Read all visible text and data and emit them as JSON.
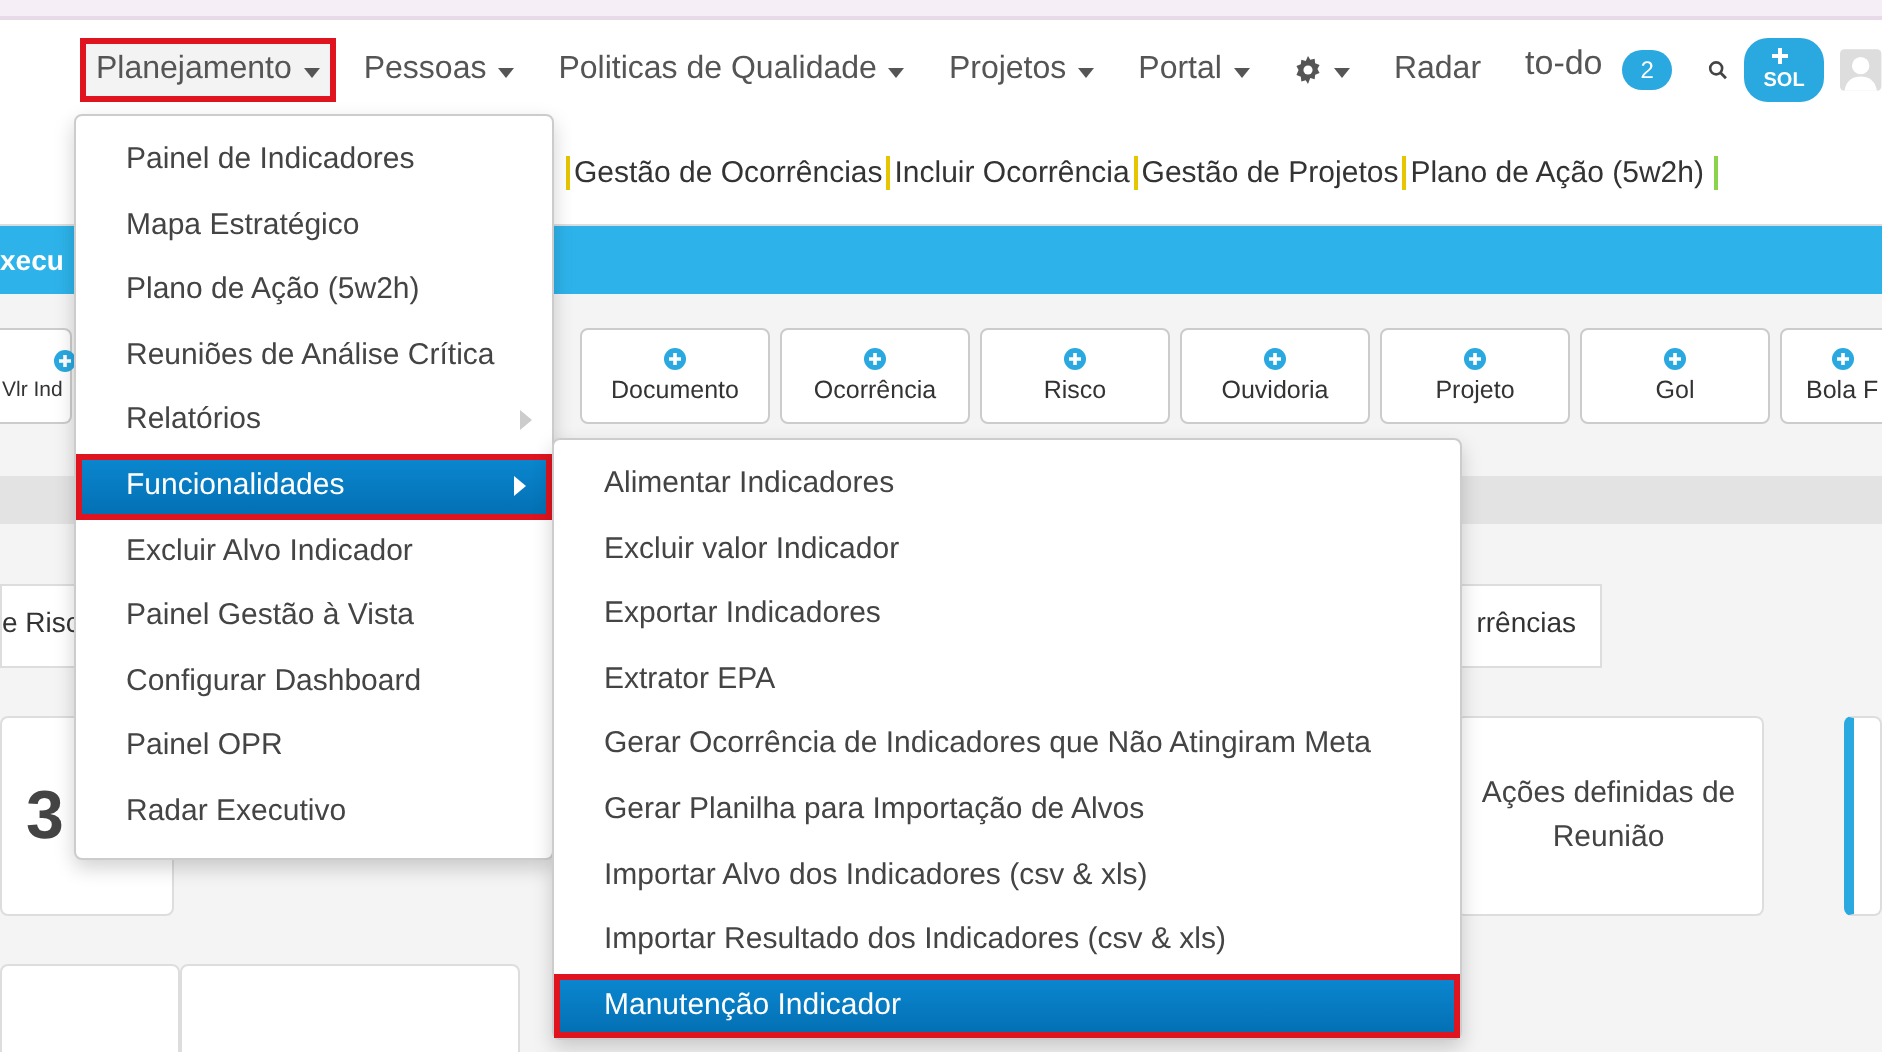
{
  "nav": {
    "items": [
      {
        "kind": "text",
        "label": "Planejamento",
        "dropdown": true,
        "selected": true
      },
      {
        "kind": "text",
        "label": "Pessoas",
        "dropdown": true,
        "selected": false
      },
      {
        "kind": "text",
        "label": "Politicas de Qualidade",
        "dropdown": true,
        "selected": false
      },
      {
        "kind": "text",
        "label": "Projetos",
        "dropdown": true,
        "selected": false
      },
      {
        "kind": "text",
        "label": "Portal",
        "dropdown": true,
        "selected": false
      },
      {
        "kind": "gear",
        "dropdown": true,
        "selected": false
      },
      {
        "kind": "text",
        "label": "Radar",
        "dropdown": false,
        "selected": false
      }
    ],
    "todo": {
      "label": "to-do",
      "count": "2"
    },
    "sol": {
      "label": "SOL"
    }
  },
  "quick_links": [
    "Gestão de Ocorrências",
    "Incluir Ocorrência",
    "Gestão de Projetos",
    "Plano de Ação (5w2h)"
  ],
  "banner": {
    "title": "xecu"
  },
  "quick_add": [
    "Vlr Ind",
    "Documento",
    "Ocorrência",
    "Risco",
    "Ouvidoria",
    "Projeto",
    "Gol",
    "Bola F"
  ],
  "tabs": [
    "e Risc",
    "rrências"
  ],
  "cards": [
    {
      "value": "3"
    },
    {
      "title": "Ações definidas de Reunião"
    }
  ],
  "menu": {
    "items": [
      {
        "label": "Painel de Indicadores",
        "submenu": false,
        "selected": false
      },
      {
        "label": "Mapa Estratégico",
        "submenu": false,
        "selected": false
      },
      {
        "label": "Plano de Ação (5w2h)",
        "submenu": false,
        "selected": false
      },
      {
        "label": "Reuniões de Análise Crítica",
        "submenu": false,
        "selected": false
      },
      {
        "label": "Relatórios",
        "submenu": true,
        "selected": false
      },
      {
        "label": "Funcionalidades",
        "submenu": true,
        "selected": true
      },
      {
        "label": "Excluir Alvo Indicador",
        "submenu": false,
        "selected": false
      },
      {
        "label": "Painel Gestão à Vista",
        "submenu": false,
        "selected": false
      },
      {
        "label": "Configurar Dashboard",
        "submenu": false,
        "selected": false
      },
      {
        "label": "Painel OPR",
        "submenu": false,
        "selected": false
      },
      {
        "label": "Radar Executivo",
        "submenu": false,
        "selected": false
      }
    ]
  },
  "submenu": {
    "items": [
      {
        "label": "Alimentar Indicadores",
        "selected": false
      },
      {
        "label": "Excluir valor Indicador",
        "selected": false
      },
      {
        "label": "Exportar Indicadores",
        "selected": false
      },
      {
        "label": "Extrator EPA",
        "selected": false
      },
      {
        "label": "Gerar Ocorrência de Indicadores que Não Atingiram Meta",
        "selected": false
      },
      {
        "label": "Gerar Planilha para Importação de Alvos",
        "selected": false
      },
      {
        "label": "Importar Alvo dos Indicadores (csv & xls)",
        "selected": false
      },
      {
        "label": "Importar Resultado dos Indicadores (csv & xls)",
        "selected": false
      },
      {
        "label": "Manutenção Indicador",
        "selected": true
      }
    ]
  }
}
